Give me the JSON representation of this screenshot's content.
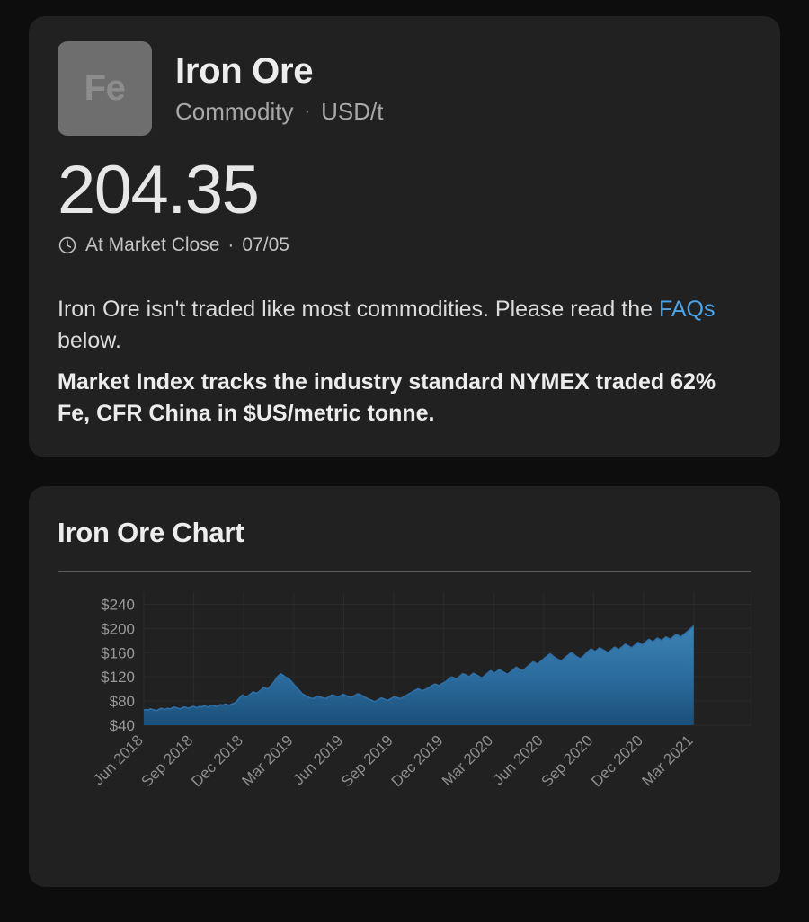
{
  "theme": {
    "page_bg": "#0d0d0d",
    "card_bg": "#212121",
    "text": "#e8e8e8",
    "muted": "#a8a8a8",
    "link": "#4da3e8",
    "divider": "#5d5d5d",
    "tile_bg": "#6e6e6e",
    "tile_text": "#8d8d8d",
    "series_line": "#2f6fa8",
    "series_fill_top": "#3d82b4",
    "series_fill_bottom": "#1a4f77",
    "gridline": "#2b2b2b"
  },
  "header": {
    "symbol_tile": "Fe",
    "title": "Iron Ore",
    "category": "Commodity",
    "separator": "·",
    "unit": "USD/t",
    "price": "204.35",
    "status_icon": "clock-icon",
    "status_text": "At Market Close",
    "status_separator": "·",
    "status_date": "07/05",
    "description_part1": "Iron Ore isn't traded like most commodities. Please read the ",
    "description_link": "FAQs",
    "description_part2": " below.",
    "description_bold": "Market Index tracks the industry standard NYMEX traded 62% Fe, CFR China in $US/metric tonne."
  },
  "chart_card": {
    "title": "Iron Ore Chart"
  },
  "chart_data": {
    "type": "area",
    "title": "Iron Ore Chart",
    "xlabel": "",
    "ylabel": "",
    "ylim": [
      40,
      260
    ],
    "ytick_labels": [
      "$240",
      "$200",
      "$160",
      "$120",
      "$80",
      "$40"
    ],
    "ytick_values": [
      240,
      200,
      160,
      120,
      80,
      40
    ],
    "xtick_labels": [
      "Jun 2018",
      "Sep 2018",
      "Dec 2018",
      "Mar 2019",
      "Jun 2019",
      "Sep 2019",
      "Dec 2019",
      "Mar 2020",
      "Jun 2020",
      "Sep 2020",
      "Dec 2020",
      "Mar 2021"
    ],
    "xtick_rotation_deg": -45,
    "grid": true,
    "legend": "none",
    "series": [
      {
        "name": "Iron Ore",
        "unit": "USD/t",
        "values": [
          65,
          66,
          65,
          67,
          66,
          65,
          64,
          66,
          68,
          67,
          66,
          68,
          67,
          68,
          70,
          69,
          68,
          67,
          69,
          70,
          69,
          68,
          70,
          71,
          70,
          69,
          71,
          70,
          72,
          71,
          70,
          72,
          73,
          72,
          71,
          73,
          74,
          73,
          75,
          74,
          73,
          75,
          76,
          78,
          82,
          86,
          90,
          88,
          87,
          89,
          92,
          95,
          94,
          93,
          96,
          99,
          103,
          101,
          100,
          104,
          108,
          112,
          118,
          122,
          125,
          123,
          120,
          118,
          116,
          112,
          108,
          104,
          100,
          96,
          92,
          90,
          88,
          86,
          85,
          84,
          86,
          88,
          87,
          86,
          85,
          84,
          86,
          88,
          90,
          89,
          88,
          87,
          89,
          91,
          90,
          88,
          87,
          86,
          88,
          90,
          92,
          91,
          89,
          87,
          85,
          83,
          82,
          80,
          79,
          81,
          83,
          85,
          84,
          82,
          81,
          83,
          85,
          87,
          86,
          85,
          84,
          86,
          88,
          90,
          92,
          94,
          96,
          98,
          100,
          99,
          97,
          98,
          100,
          102,
          104,
          106,
          108,
          107,
          105,
          108,
          110,
          112,
          115,
          118,
          120,
          118,
          116,
          119,
          122,
          125,
          124,
          122,
          120,
          123,
          126,
          124,
          122,
          120,
          118,
          121,
          124,
          127,
          130,
          128,
          126,
          129,
          132,
          130,
          128,
          126,
          124,
          127,
          130,
          133,
          136,
          134,
          132,
          130,
          133,
          136,
          139,
          142,
          145,
          143,
          141,
          144,
          147,
          150,
          153,
          156,
          158,
          155,
          152,
          150,
          148,
          146,
          149,
          152,
          155,
          158,
          160,
          157,
          154,
          152,
          150,
          153,
          156,
          160,
          163,
          166,
          164,
          162,
          165,
          168,
          166,
          164,
          162,
          160,
          163,
          166,
          169,
          167,
          165,
          168,
          171,
          174,
          172,
          170,
          168,
          171,
          174,
          177,
          175,
          173,
          176,
          179,
          182,
          180,
          178,
          181,
          184,
          182,
          180,
          183,
          186,
          184,
          182,
          185,
          188,
          190,
          188,
          186,
          189,
          192,
          195,
          198,
          201,
          204.35
        ]
      }
    ],
    "first_value": 65,
    "last_value": 204.35,
    "min_value": 64,
    "max_value": 204.35
  }
}
